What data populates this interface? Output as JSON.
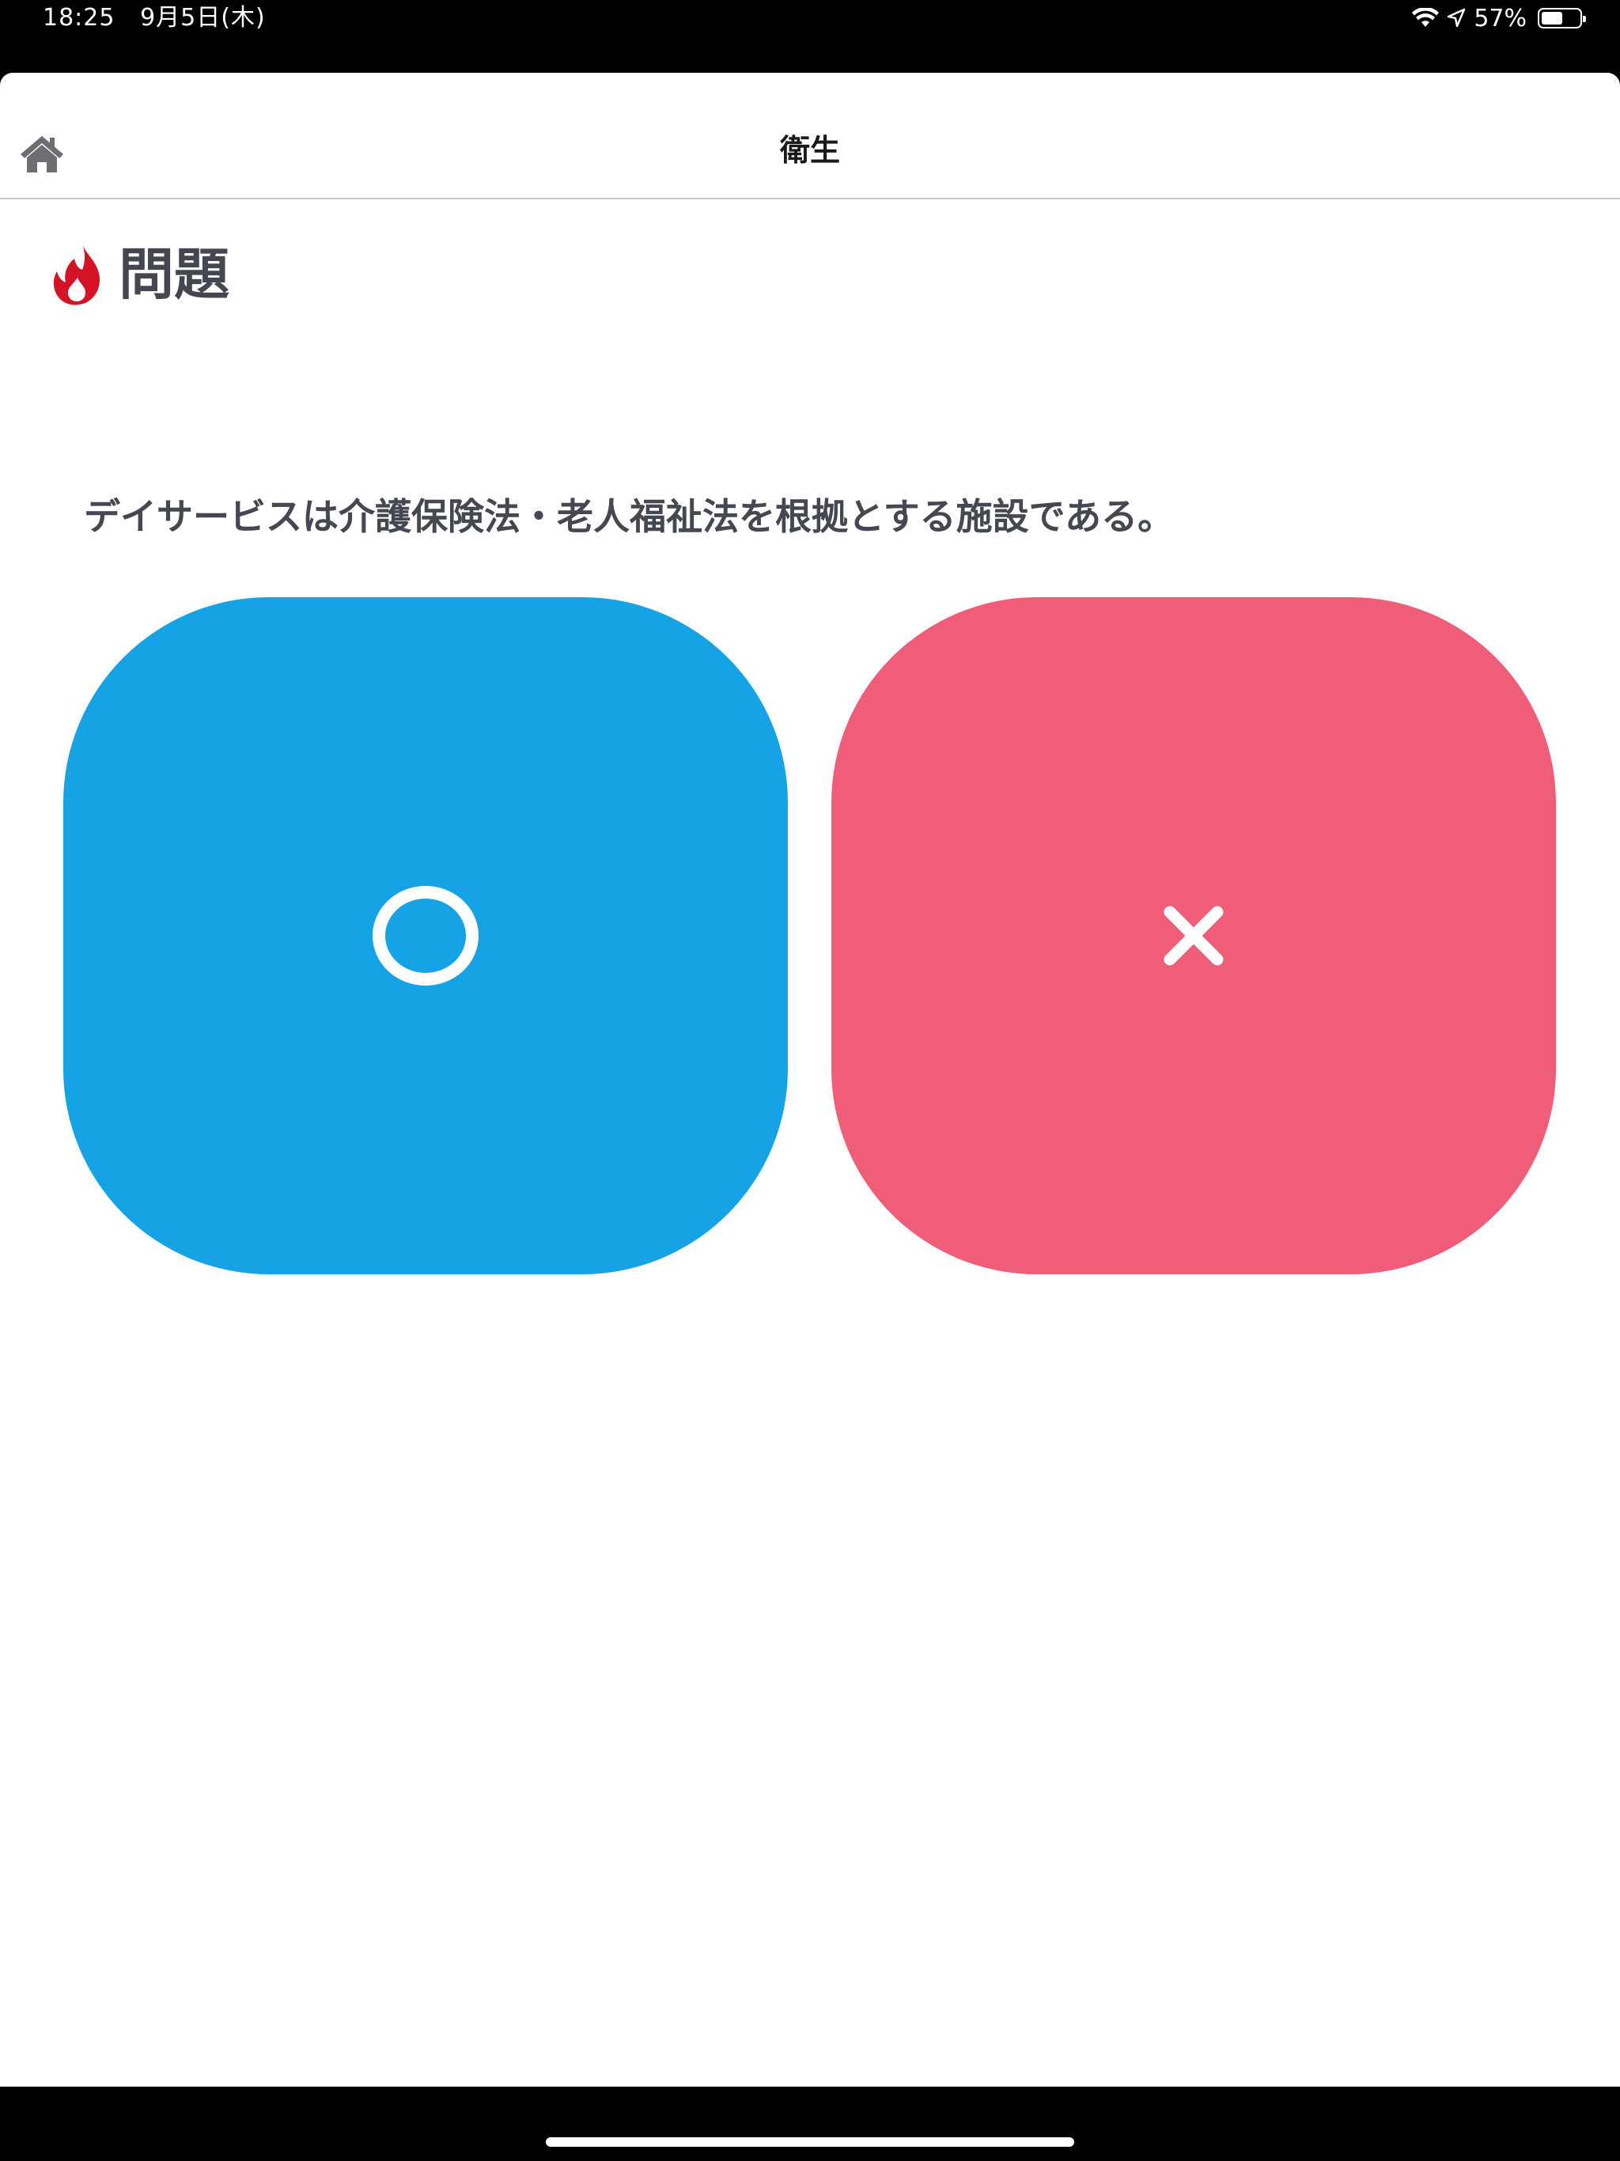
{
  "status_bar": {
    "time": "18:25",
    "date": "9月5日(木)",
    "battery_text": "57%",
    "battery_level": 0.57,
    "icons": [
      "wifi-icon",
      "location-arrow-icon",
      "battery-icon"
    ]
  },
  "nav": {
    "title": "衛生",
    "home_icon": "home-icon"
  },
  "heading": {
    "icon": "flame-icon",
    "label": "問題"
  },
  "question": {
    "text": "デイサービスは介護保険法・老人福祉法を根拠とする施設である。"
  },
  "answers": {
    "true_icon": "circle-icon",
    "false_icon": "cross-icon"
  },
  "colors": {
    "true_button": "#16a3e6",
    "false_button": "#ef5d79",
    "flame": "#d51327",
    "text": "#454850"
  }
}
